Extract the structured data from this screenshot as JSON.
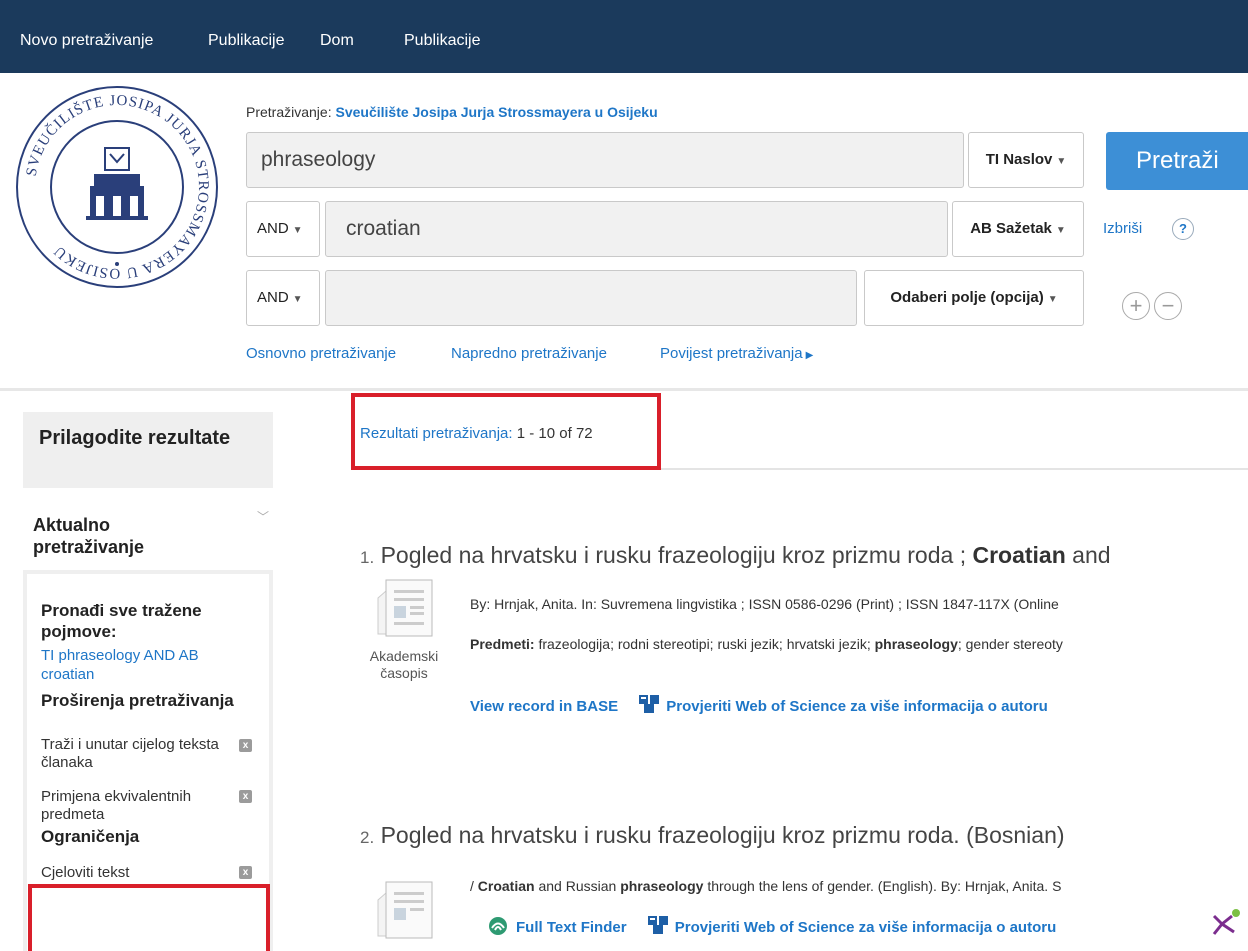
{
  "nav": {
    "items": [
      "Novo pretraživanje",
      "Publikacije",
      "Dom",
      "Publikacije"
    ]
  },
  "logo": {
    "arc_text": "SVEUČILIŠTE JOSIPA JURJA STROSSMAYERA U OSIJEKU"
  },
  "search": {
    "label": "Pretraživanje:",
    "institution": "Sveučilište Josipa Jurja Strossmayera u Osijeku",
    "rows": [
      {
        "bool": "",
        "value": "phraseology",
        "field": "TI Naslov"
      },
      {
        "bool": "AND",
        "value": "croatian",
        "field": "AB Sažetak"
      },
      {
        "bool": "AND",
        "value": "",
        "field": "Odaberi polje (opcija)"
      }
    ],
    "button": "Pretraži",
    "clear": "Izbriši",
    "help": "?",
    "add": "+",
    "remove": "−",
    "links": [
      "Osnovno pretraživanje",
      "Napredno pretraživanje",
      "Povijest pretraživanja"
    ]
  },
  "sidebar": {
    "title": "Prilagodite rezultate",
    "current": "Aktualno pretraživanje",
    "find_all": "Pronađi sve tražene pojmove:",
    "query": "TI phraseology AND AB croatian",
    "expanders_title": "Proširenja pretraživanja",
    "expanders": [
      "Traži i unutar cijelog teksta članaka",
      "Primjena ekvivalentnih predmeta"
    ],
    "limits_title": "Ograničenja",
    "limits": [
      "Cjeloviti tekst"
    ],
    "remove_icon": "x"
  },
  "results": {
    "label": "Rezultati pretraživanja:",
    "range": "1 - 10 of 72",
    "items": [
      {
        "num": "1.",
        "title_pre": "Pogled na hrvatsku i rusku frazeologiju kroz prizmu roda ; ",
        "title_bold": "Croatian",
        "title_post": " and",
        "line1": "By: Hrnjak, Anita. In: Suvremena lingvistika ; ISSN 0586-0296 (Print) ; ISSN 1847-117X (Online",
        "subjects_label": "Predmeti:",
        "subjects_pre": " frazeologija; rodni stereotipi; ruski jezik; hrvatski jezik; ",
        "subjects_bold": "phraseology",
        "subjects_post": "; gender stereoty",
        "type": "Akademski časopis",
        "link1": "View record in BASE",
        "link2": "Provjeriti Web of Science za više informacija o autoru"
      },
      {
        "num": "2.",
        "title": "Pogled na hrvatsku i rusku frazeologiju kroz prizmu roda. (Bosnian)",
        "line_pre": "/ ",
        "line_b1": "Croatian",
        "line_mid": " and Russian ",
        "line_b2": "phraseology",
        "line_post": " through the lens of gender. (English). By: Hrnjak, Anita. S",
        "link1": "Full Text Finder",
        "link2": "Provjeriti Web of Science za više informacija o autoru"
      }
    ]
  },
  "colors": {
    "nav_bg": "#1b3a5c",
    "accent": "#1e76c7",
    "button": "#3d8fd6",
    "highlight_box": "#d91f2a"
  }
}
